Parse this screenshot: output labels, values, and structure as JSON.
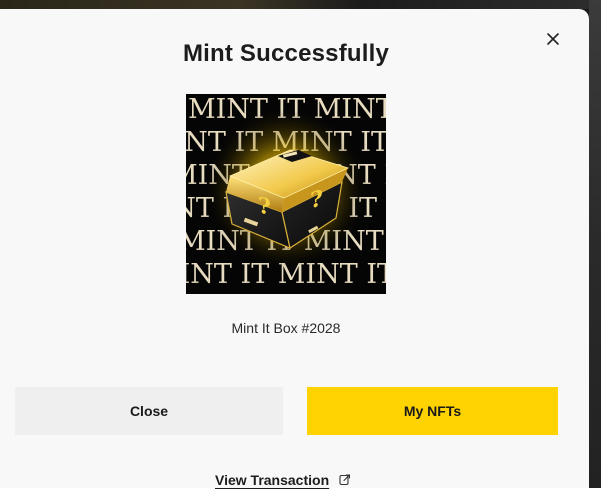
{
  "modal": {
    "title": "Mint Successfully",
    "close_icon": "close-icon",
    "nft": {
      "name": "Mint It Box #2028",
      "image_text": "MINT IT",
      "box_glyph": "?",
      "image_colors": {
        "background": "#050505",
        "text": "#e8dcc0",
        "gold": "#f4d03f",
        "box_dark": "#1b1b1b"
      }
    },
    "buttons": {
      "close_label": "Close",
      "my_nfts_label": "My NFTs"
    },
    "link": {
      "label": "View Transaction",
      "icon": "external-link-icon"
    }
  },
  "colors": {
    "accent": "#ffd300",
    "modal_bg": "#f8f8f8",
    "secondary_button": "#efefef",
    "text": "#1c1c1c"
  }
}
